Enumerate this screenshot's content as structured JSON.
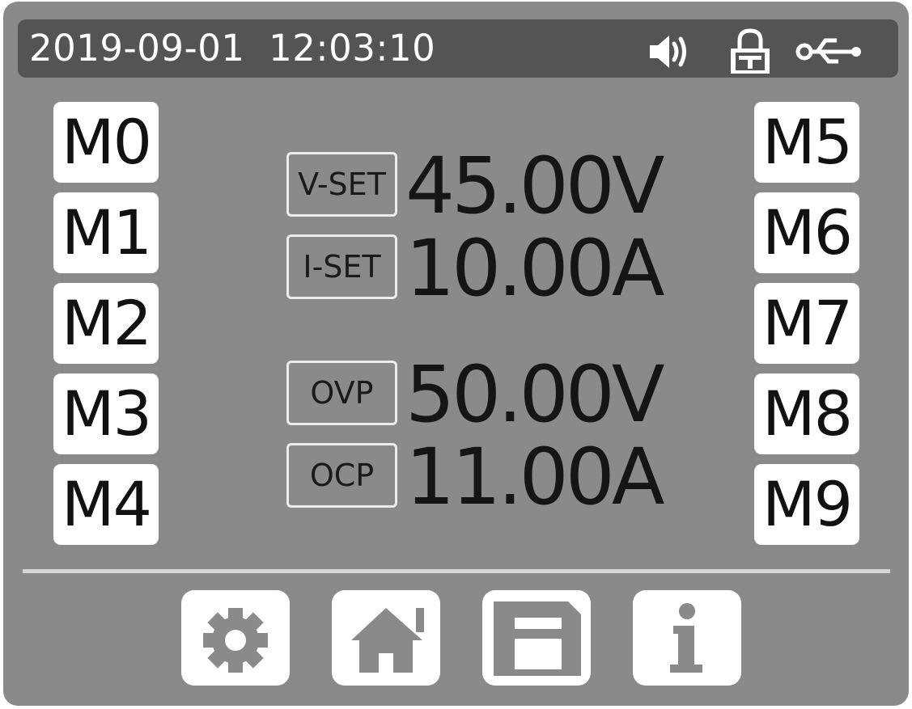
{
  "status_bar": {
    "date": "2019-09-01",
    "time": "12:03:10",
    "icons": [
      "speaker-icon",
      "lock-icon",
      "usb-icon"
    ]
  },
  "memory_left": [
    {
      "label": "M0"
    },
    {
      "label": "M1"
    },
    {
      "label": "M2"
    },
    {
      "label": "M3"
    },
    {
      "label": "M4"
    }
  ],
  "memory_right": [
    {
      "label": "M5"
    },
    {
      "label": "M6"
    },
    {
      "label": "M7"
    },
    {
      "label": "M8"
    },
    {
      "label": "M9"
    }
  ],
  "params": {
    "vset": {
      "label": "V-SET",
      "value": "45.00V"
    },
    "iset": {
      "label": "I-SET",
      "value": "10.00A"
    },
    "ovp": {
      "label": "OVP",
      "value": "50.00V"
    },
    "ocp": {
      "label": "OCP",
      "value": "11.00A"
    }
  },
  "toolbar": {
    "icons": [
      "settings-icon",
      "home-icon",
      "save-icon",
      "info-icon"
    ]
  },
  "colors": {
    "background": "#8a8a8a",
    "status_bar": "#545454",
    "button": "#ffffff",
    "text_dark": "#151515"
  }
}
